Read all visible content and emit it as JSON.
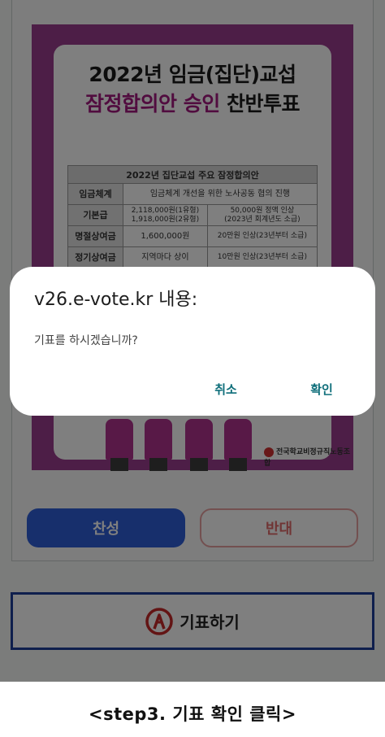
{
  "poster": {
    "title_line1": "2022년 임금(집단)교섭",
    "title_line2_highlight": "잠정합의안 승인",
    "title_line2_rest": " 찬반투표",
    "table_title": "2022년 집단교섭 주요 잠정합의안",
    "rows": [
      {
        "label": "임금체계",
        "col1": "임금체계 개선을 위한 노사공동 협의 진행",
        "col2": ""
      },
      {
        "label": "기본급",
        "col1": "2,118,000원(1유형)\n1,918,000원(2유형)",
        "col2": "50,000원 정액 인상\n(2023년 회계년도 소급)"
      },
      {
        "label": "명절상여금",
        "col1": "1,600,000원",
        "col2": "20만원 인상(23년부터 소급)"
      },
      {
        "label": "정기상여금",
        "col1": "지역마다 상이",
        "col2": "10만원 인상(23년부터 소급)"
      }
    ],
    "union_name": "전국학교비정규직노동조합"
  },
  "buttons": {
    "yes": "찬성",
    "no": "반대",
    "vote": "기표하기"
  },
  "dialog": {
    "title": "v26.e-vote.kr 내용:",
    "message": "기표를 하시겠습니까?",
    "cancel": "취소",
    "ok": "확인"
  },
  "caption": "<step3.  기표 확인 클릭>",
  "colors": {
    "poster_purple": "#9b3c8e",
    "highlight": "#a3197f",
    "yes_blue": "#2f5fd8",
    "no_red": "#e06a6a",
    "dialog_action": "#0e6e7a"
  }
}
